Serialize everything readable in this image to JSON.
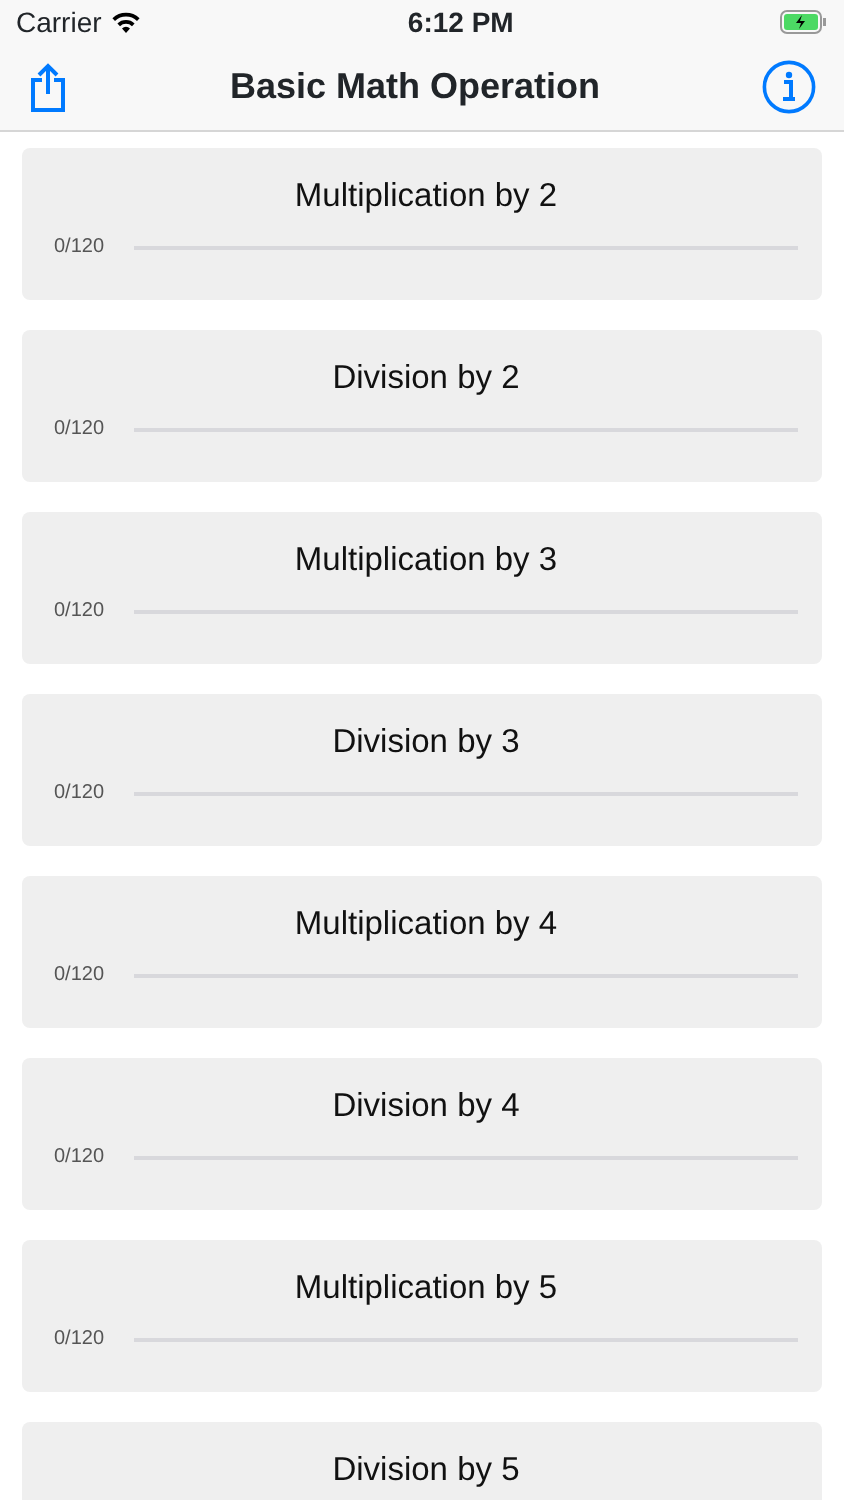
{
  "status_bar": {
    "carrier": "Carrier",
    "time": "6:12 PM"
  },
  "nav_bar": {
    "title": "Basic Math Operation"
  },
  "lessons": [
    {
      "title": "Multiplication by 2",
      "progress": "0/120"
    },
    {
      "title": "Division by 2",
      "progress": "0/120"
    },
    {
      "title": "Multiplication by 3",
      "progress": "0/120"
    },
    {
      "title": "Division by 3",
      "progress": "0/120"
    },
    {
      "title": "Multiplication by 4",
      "progress": "0/120"
    },
    {
      "title": "Division by 4",
      "progress": "0/120"
    },
    {
      "title": "Multiplication by 5",
      "progress": "0/120"
    },
    {
      "title": "Division by 5"
    }
  ]
}
